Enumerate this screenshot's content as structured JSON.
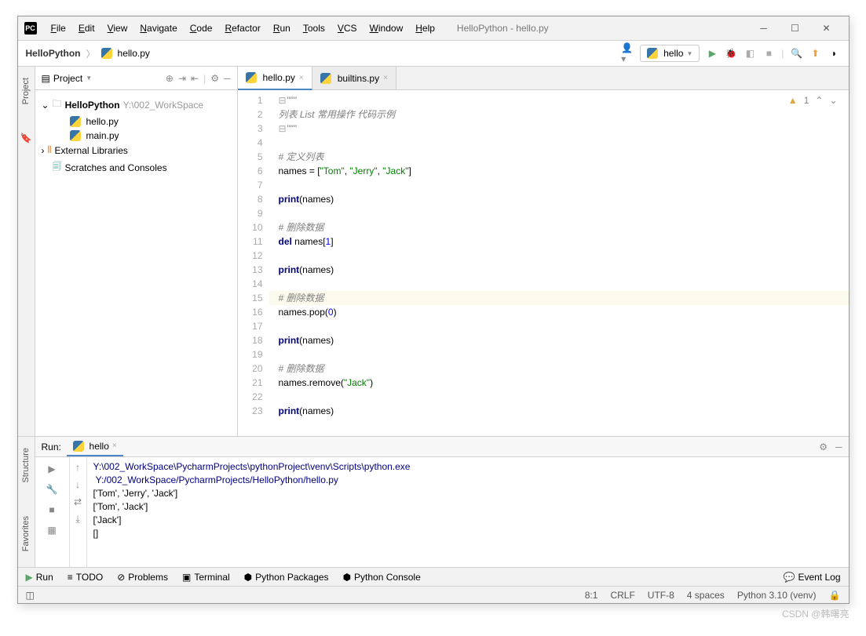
{
  "window_title": "HelloPython - hello.py",
  "menu": [
    "File",
    "Edit",
    "View",
    "Navigate",
    "Code",
    "Refactor",
    "Run",
    "Tools",
    "VCS",
    "Window",
    "Help"
  ],
  "breadcrumb": {
    "project": "HelloPython",
    "file": "hello.py"
  },
  "run_config": "hello",
  "project_panel": {
    "title": "Project",
    "root": "HelloPython",
    "root_path": "Y:\\002_WorkSpace",
    "files": [
      "hello.py",
      "main.py"
    ],
    "ext_lib": "External Libraries",
    "scratches": "Scratches and Consoles"
  },
  "tabs": [
    {
      "name": "hello.py",
      "active": true
    },
    {
      "name": "builtins.py",
      "active": false
    }
  ],
  "warnings_count": "1",
  "code": {
    "lines": [
      {
        "n": 1,
        "html": "<span class='fold-mark'>⊟</span><span class='tok-com'>\"\"\"</span>"
      },
      {
        "n": 2,
        "html": "<span class='tok-com'>列表 List 常用操作 代码示例</span>"
      },
      {
        "n": 3,
        "html": "<span class='fold-mark'>⊟</span><span class='tok-com'>\"\"\"</span>"
      },
      {
        "n": 4,
        "html": ""
      },
      {
        "n": 5,
        "html": "<span class='tok-com'># 定义列表</span>"
      },
      {
        "n": 6,
        "html": "names = [<span class='tok-str'>\"Tom\"</span>, <span class='tok-str'>\"Jerry\"</span>, <span class='tok-str'>\"Jack\"</span>]"
      },
      {
        "n": 7,
        "html": ""
      },
      {
        "n": 8,
        "html": "<span class='tok-kw'>print</span>(names)"
      },
      {
        "n": 9,
        "html": ""
      },
      {
        "n": 10,
        "html": "<span class='tok-com'># 删除数据</span>"
      },
      {
        "n": 11,
        "html": "<span class='tok-kw'>del</span> names[<span class='tok-num'>1</span>]"
      },
      {
        "n": 12,
        "html": ""
      },
      {
        "n": 13,
        "html": "<span class='tok-kw'>print</span>(names)"
      },
      {
        "n": 14,
        "html": ""
      },
      {
        "n": 15,
        "hl": true,
        "html": "<span class='tok-com'># 删除数据</span>"
      },
      {
        "n": 16,
        "html": "names.pop(<span class='tok-num'>0</span>)"
      },
      {
        "n": 17,
        "html": ""
      },
      {
        "n": 18,
        "html": "<span class='tok-kw'>print</span>(names)"
      },
      {
        "n": 19,
        "html": ""
      },
      {
        "n": 20,
        "html": "<span class='tok-com'># 删除数据</span>"
      },
      {
        "n": 21,
        "html": "names.remove(<span class='tok-str'>\"Jack\"</span>)"
      },
      {
        "n": 22,
        "html": ""
      },
      {
        "n": 23,
        "html": "<span class='tok-kw'>print</span>(names)"
      }
    ]
  },
  "run": {
    "label": "Run:",
    "tab": "hello",
    "output": [
      {
        "cls": "path",
        "text": "Y:\\002_WorkSpace\\PycharmProjects\\pythonProject\\venv\\Scripts\\python.exe"
      },
      {
        "cls": "path",
        "text": " Y:/002_WorkSpace/PycharmProjects/HelloPython/hello.py"
      },
      {
        "cls": "",
        "text": "['Tom', 'Jerry', 'Jack']"
      },
      {
        "cls": "",
        "text": "['Tom', 'Jack']"
      },
      {
        "cls": "",
        "text": "['Jack']"
      },
      {
        "cls": "",
        "text": "[]"
      }
    ]
  },
  "bottom_tools": [
    "Run",
    "TODO",
    "Problems",
    "Terminal",
    "Python Packages",
    "Python Console"
  ],
  "event_log": "Event Log",
  "status": {
    "pos": "8:1",
    "eol": "CRLF",
    "enc": "UTF-8",
    "indent": "4 spaces",
    "python": "Python 3.10 (venv)"
  },
  "sidebar_left": [
    "Project"
  ],
  "sidebar_left2": [
    "Structure",
    "Favorites"
  ],
  "watermark": "CSDN @韩曙亮"
}
